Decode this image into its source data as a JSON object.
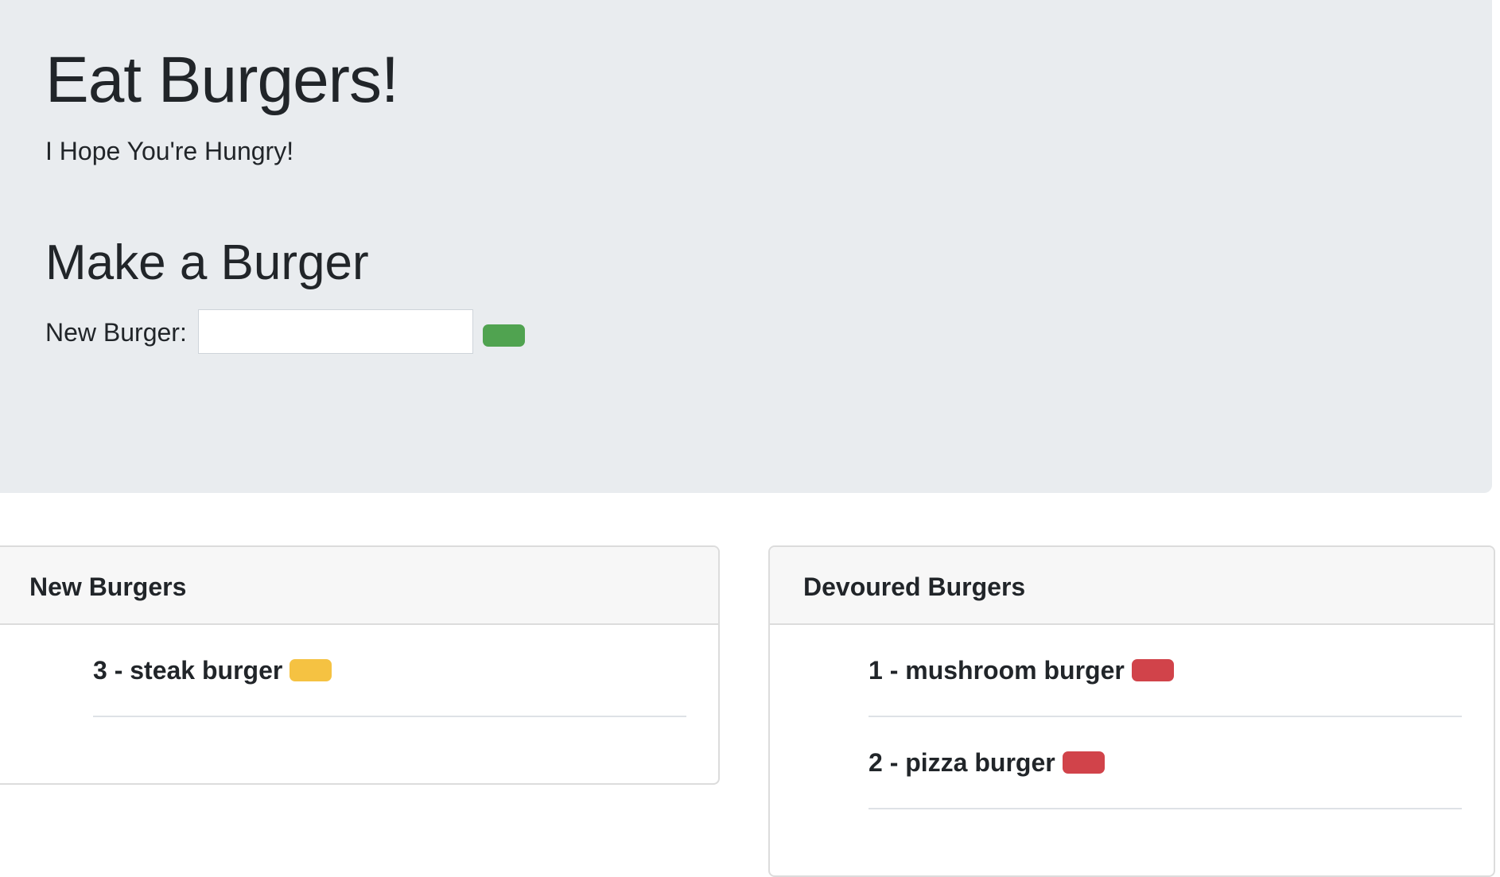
{
  "header": {
    "title": "Eat Burgers!",
    "subtitle": "I Hope You're Hungry!"
  },
  "form": {
    "section_title": "Make a Burger",
    "label": "New Burger:",
    "input_value": "",
    "submit_label": "",
    "submit_color": "#50a350"
  },
  "new_burgers": {
    "title": "New Burgers",
    "items": [
      {
        "text": "3 - steak burger",
        "button_label": "",
        "button_color": "#f5c242"
      }
    ]
  },
  "devoured_burgers": {
    "title": "Devoured Burgers",
    "items": [
      {
        "text": "1 - mushroom burger",
        "button_label": "",
        "button_color": "#d1434a"
      },
      {
        "text": "2 - pizza burger",
        "button_label": "",
        "button_color": "#d1434a"
      }
    ]
  },
  "colors": {
    "jumbotron_bg": "#e9ecef",
    "card_header_bg": "#f7f7f7",
    "text": "#212529"
  }
}
